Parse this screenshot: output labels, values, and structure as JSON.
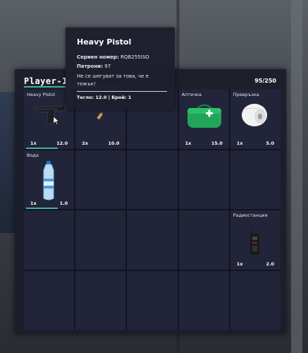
{
  "player": {
    "name": "Player-14",
    "capacity": "95/250"
  },
  "tooltip": {
    "title": "Heavy Pistol",
    "serial_label": "Сериен номер:",
    "serial_value": "RQB255ISO",
    "ammo_label": "Патрони:",
    "ammo_value": "97",
    "description": "Не се шегуват за това, че е тежък!",
    "footer": "Тегло: 12.0 | Брой: 1"
  },
  "slots": [
    {
      "label": "Heavy Pistol",
      "count": "1x",
      "weight": "12.0",
      "icon": "pistol-icon"
    },
    {
      "label": "",
      "count": "2x",
      "weight": "10.0",
      "icon": "bullet-icon"
    },
    {
      "label": "",
      "count": "",
      "weight": "",
      "icon": ""
    },
    {
      "label": "Аптечка",
      "count": "1x",
      "weight": "15.0",
      "icon": "medkit-icon"
    },
    {
      "label": "Превръзка",
      "count": "1x",
      "weight": "5.0",
      "icon": "bandage-icon"
    },
    {
      "label": "Вода",
      "count": "1x",
      "weight": "1.0",
      "icon": "water-bottle-icon"
    },
    {
      "label": "Радиостанция",
      "count": "1x",
      "weight": "2.0",
      "icon": "radio-icon"
    }
  ],
  "colors": {
    "accent": "#3fb6a0",
    "panel": "#1b1d2a",
    "slot": "#22243a"
  }
}
